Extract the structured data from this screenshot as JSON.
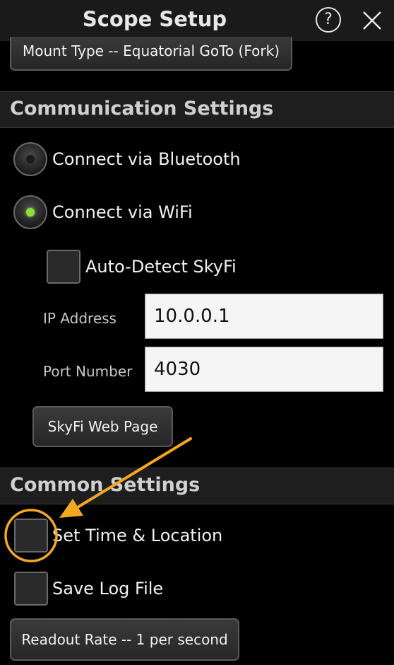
{
  "header": {
    "title": "Scope Setup",
    "help_label": "?"
  },
  "mount": {
    "button_label": "Mount Type -- Equatorial GoTo (Fork)"
  },
  "communication": {
    "section_title": "Communication Settings",
    "options": [
      {
        "label": "Connect via Bluetooth",
        "selected": false
      },
      {
        "label": "Connect via WiFi",
        "selected": true
      }
    ],
    "auto_detect": {
      "label": "Auto-Detect SkyFi",
      "checked": false
    },
    "ip_address": {
      "label": "IP Address",
      "value": "10.0.0.1"
    },
    "port_number": {
      "label": "Port Number",
      "value": "4030"
    },
    "web_page_button": "SkyFi Web Page"
  },
  "common": {
    "section_title": "Common Settings",
    "set_time": {
      "label": "Set Time & Location",
      "checked": false
    },
    "save_log": {
      "label": "Save Log File",
      "checked": false
    },
    "readout_button": "Readout Rate -- 1 per second"
  },
  "annotation": {
    "highlight_color": "#f5a623",
    "accent_on": "#8de03a"
  }
}
